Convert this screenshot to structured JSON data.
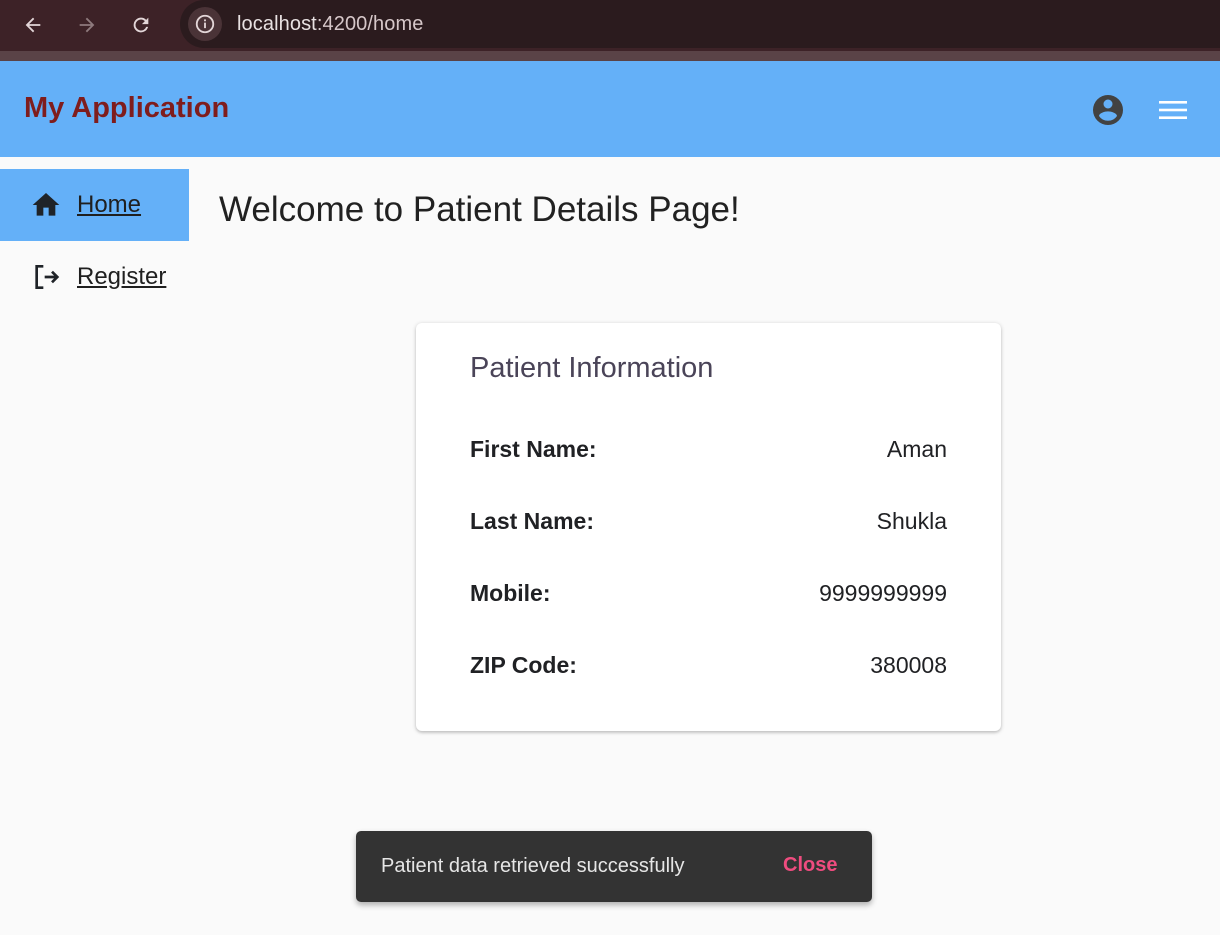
{
  "browser": {
    "url_host": "localhost",
    "url_path": ":4200/home",
    "icons": [
      "back-arrow-icon",
      "forward-arrow-icon",
      "reload-icon",
      "info-icon"
    ]
  },
  "toolbar": {
    "title": "My Application",
    "icons": [
      "account-circle-icon",
      "menu-icon"
    ],
    "background": "#64b0f8",
    "title_color": "#7f1d1d"
  },
  "sidebar": {
    "items": [
      {
        "label": "Home",
        "icon": "home-icon",
        "active": true
      },
      {
        "label": "Register",
        "icon": "logout-icon",
        "active": false
      }
    ]
  },
  "main": {
    "heading": "Welcome to Patient Details Page!",
    "card": {
      "title": "Patient Information",
      "rows": [
        {
          "key": "First Name:",
          "value": "Aman"
        },
        {
          "key": "Last Name:",
          "value": "Shukla"
        },
        {
          "key": "Mobile:",
          "value": "9999999999"
        },
        {
          "key": "ZIP Code:",
          "value": "380008"
        }
      ]
    }
  },
  "snackbar": {
    "message": "Patient data retrieved successfully",
    "action": "Close",
    "action_color": "#ef4c7f"
  }
}
